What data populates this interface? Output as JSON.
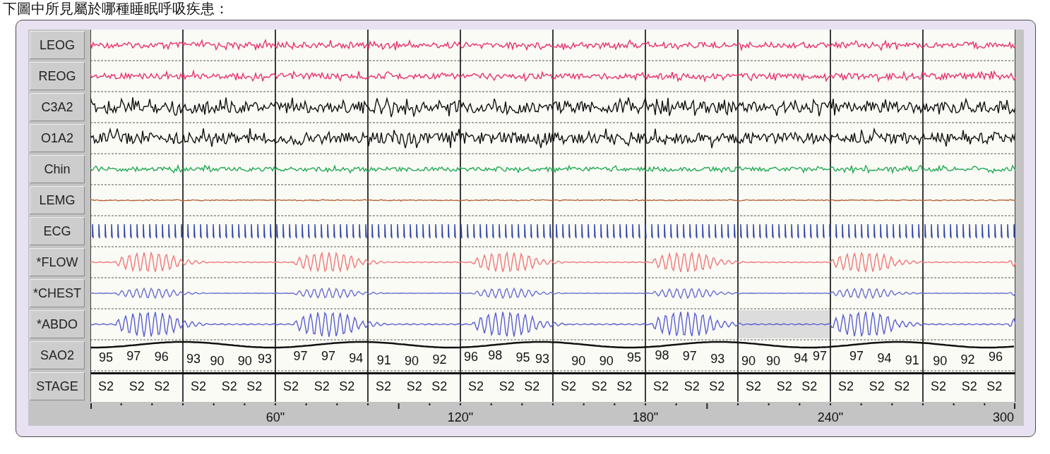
{
  "question": "下圖中所見屬於哪種睡眠呼吸疾患：",
  "channels": [
    {
      "name": "LEOG",
      "kind": "eog",
      "color": "#e8336e",
      "marked": false
    },
    {
      "name": "REOG",
      "kind": "eog",
      "color": "#e8336e",
      "marked": false
    },
    {
      "name": "C3A2",
      "kind": "eeg",
      "color": "#111111",
      "marked": false
    },
    {
      "name": "O1A2",
      "kind": "eeg",
      "color": "#111111",
      "marked": false
    },
    {
      "name": "Chin",
      "kind": "emg",
      "color": "#22aa55",
      "marked": false
    },
    {
      "name": "LEMG",
      "kind": "leg",
      "color": "#b5653a",
      "marked": false
    },
    {
      "name": "ECG",
      "kind": "ecg",
      "color": "#2a3fa8",
      "marked": false
    },
    {
      "name": "*FLOW",
      "kind": "flow",
      "color": "#f07878",
      "marked": false
    },
    {
      "name": "*CHEST",
      "kind": "chest",
      "color": "#6a6fd0",
      "marked": false
    },
    {
      "name": "*ABDO",
      "kind": "abdomen",
      "color": "#5a5fd0",
      "marked": true
    },
    {
      "name": "SAO2",
      "kind": "sao2",
      "color": "#111111",
      "marked": false,
      "values": [
        "95",
        "97",
        "96",
        "93",
        "90",
        "90",
        "93",
        "97",
        "97",
        "94",
        "91",
        "90",
        "92",
        "96",
        "98",
        "95",
        "93",
        "90",
        "90",
        "95",
        "98",
        "97",
        "93",
        "90",
        "90",
        "94",
        "97",
        "97",
        "94",
        "91",
        "90",
        "92",
        "96"
      ]
    },
    {
      "name": "STAGE",
      "kind": "stage",
      "color": "#111111",
      "marked": false,
      "values": [
        "S2",
        "S2",
        "S2",
        "S2",
        "S2",
        "S2",
        "S2",
        "S2",
        "S2",
        "S2",
        "S2",
        "S2",
        "S2",
        "S2",
        "S2",
        "S2",
        "S2",
        "S2",
        "S2",
        "S2",
        "S2",
        "S2",
        "S2",
        "S2",
        "S2",
        "S2",
        "S2",
        "S2",
        "S2",
        "S2"
      ]
    }
  ],
  "axis": {
    "ticks": [
      "60\"",
      "120\"",
      "180\"",
      "240\"",
      "300"
    ]
  }
}
